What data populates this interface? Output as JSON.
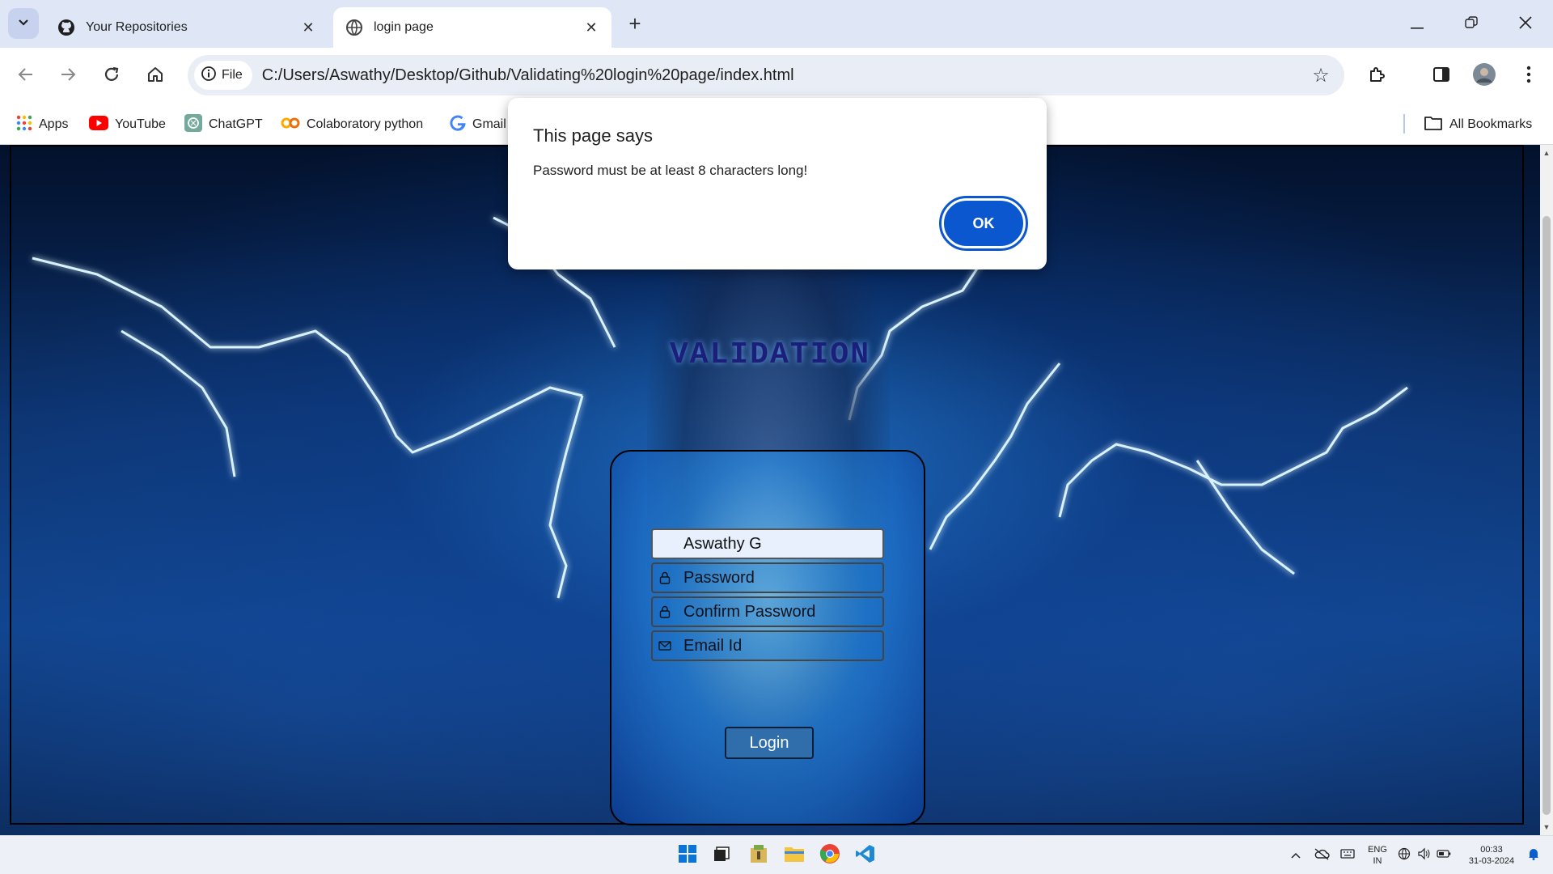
{
  "browser": {
    "tabs": [
      {
        "title": "Your Repositories",
        "icon": "github-icon"
      },
      {
        "title": "login page",
        "icon": "globe-icon"
      }
    ],
    "new_tab_label": "+",
    "address": {
      "chip_label": "File",
      "url": "C:/Users/Aswathy/Desktop/Github/Validating%20login%20page/index.html"
    },
    "bookmarks": [
      {
        "label": "Apps",
        "icon": "apps-grid-icon"
      },
      {
        "label": "YouTube",
        "icon": "youtube-icon"
      },
      {
        "label": "ChatGPT",
        "icon": "chatgpt-icon"
      },
      {
        "label": "Colaboratory python",
        "icon": "colab-icon"
      },
      {
        "label": "Gmail",
        "icon": "google-icon"
      }
    ],
    "all_bookmarks_label": "All Bookmarks"
  },
  "page": {
    "heading": "VALIDATION",
    "form": {
      "name_value": "Aswathy G",
      "password_placeholder": "Password",
      "confirm_placeholder": "Confirm Password",
      "email_placeholder": "Email Id",
      "login_label": "Login"
    }
  },
  "dialog": {
    "title": "This page says",
    "message": "Password must be at least 8 characters long!",
    "ok_label": "OK"
  },
  "taskbar": {
    "lang_top": "ENG",
    "lang_bottom": "IN",
    "time": "00:33",
    "date": "31-03-2024"
  },
  "colors": {
    "accent": "#0b57d0",
    "heading": "#1a1f7a",
    "login_button": "#2f6eaa"
  }
}
